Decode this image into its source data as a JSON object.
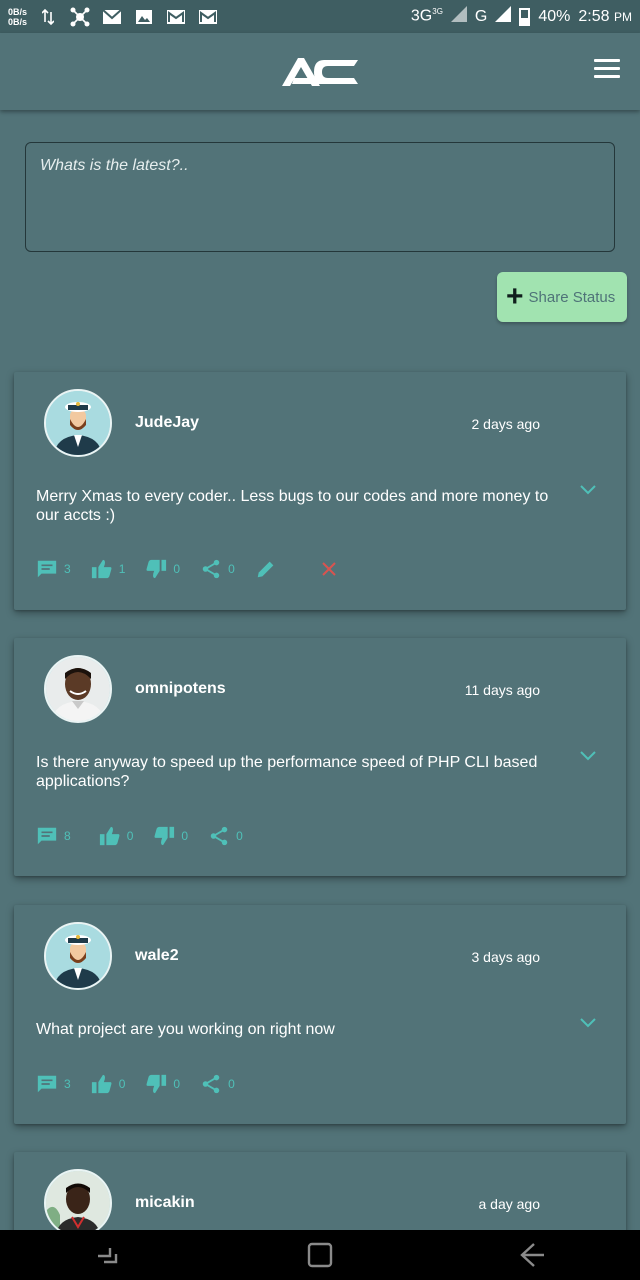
{
  "status_bar": {
    "net_up": "0B/s",
    "net_down": "0B/s",
    "network_1": "3G",
    "network_1_sub": "3G",
    "network_2": "G",
    "battery": "40%",
    "time": "2:58",
    "ampm": "PM"
  },
  "composer": {
    "placeholder": "Whats is the latest?.."
  },
  "share_button": {
    "label": "Share Status"
  },
  "colors": {
    "background": "#527378",
    "accent": "#4fc0b8",
    "share_button": "#a1e3b0",
    "delete": "#d9534f"
  },
  "posts": [
    {
      "username": "JudeJay",
      "time_ago": "2 days ago",
      "text": "Merry Xmas to every coder.. Less bugs to our codes and more money to our accts :)",
      "comments": "3",
      "likes": "1",
      "dislikes": "0",
      "shares": "0",
      "avatar": "captain-avatar-icon"
    },
    {
      "username": "omnipotens",
      "time_ago": "11 days ago",
      "text": "Is there anyway to speed up the performance speed of PHP CLI based applications?",
      "comments": "8",
      "likes": "0",
      "dislikes": "0",
      "shares": "0",
      "avatar": "photo-avatar"
    },
    {
      "username": "wale2",
      "time_ago": "3 days ago",
      "text": "What project are you working on right now",
      "comments": "3",
      "likes": "0",
      "dislikes": "0",
      "shares": "0",
      "avatar": "captain-avatar-icon"
    },
    {
      "username": "micakin",
      "time_ago": "a day ago",
      "avatar": "photo-avatar"
    }
  ]
}
